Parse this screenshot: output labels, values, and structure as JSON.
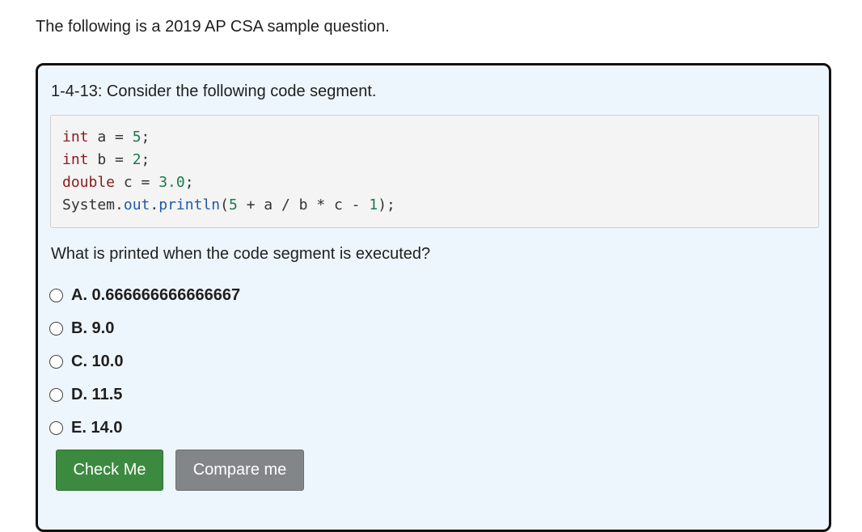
{
  "intro": "The following is a 2019 AP CSA sample question.",
  "question": {
    "heading": "1-4-13: Consider the following code segment.",
    "code": {
      "line1": {
        "kw": "int",
        "rest": " a = ",
        "num": "5",
        "end": ";"
      },
      "line2": {
        "kw": "int",
        "rest": " b = ",
        "num": "2",
        "end": ";"
      },
      "line3": {
        "kw": "double",
        "rest": " c = ",
        "num": "3.0",
        "end": ";"
      },
      "line4": {
        "a": "System",
        "b": ".",
        "c": "out",
        "d": ".",
        "e": "println",
        "f": "(",
        "g": "5",
        "h": " + a / b * c - ",
        "i": "1",
        "j": ");"
      }
    },
    "prompt": "What is printed when the code segment is executed?",
    "options": [
      {
        "label": "A. 0.666666666666667"
      },
      {
        "label": "B. 9.0"
      },
      {
        "label": "C. 10.0"
      },
      {
        "label": "D. 11.5"
      },
      {
        "label": "E. 14.0"
      }
    ],
    "buttons": {
      "check": "Check Me",
      "compare": "Compare me"
    }
  },
  "colors": {
    "card_bg": "#eef6fd",
    "check_button": "#3c8a40",
    "compare_button": "#838688",
    "keyword": "#8b1a1a",
    "number": "#1a7a4a",
    "field": "#1f5aa8"
  }
}
